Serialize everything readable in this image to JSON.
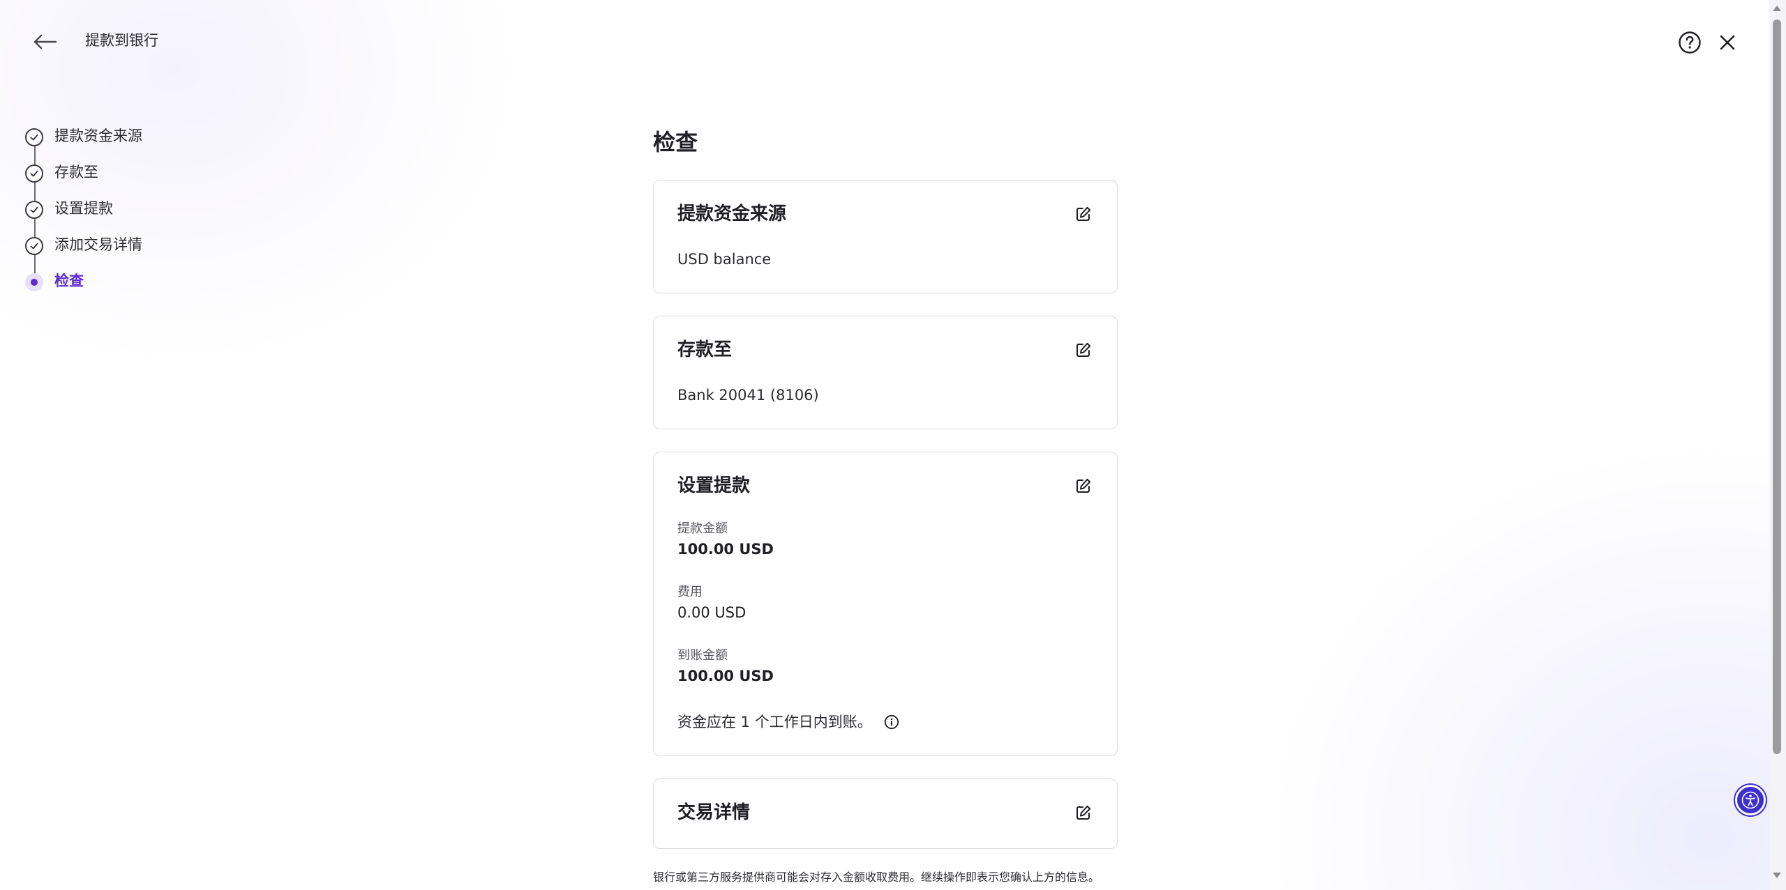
{
  "header": {
    "title": "提款到银行",
    "back_icon": "arrow-left-icon",
    "help_icon": "question-circle-icon",
    "close_icon": "close-icon"
  },
  "stepper": {
    "steps": [
      {
        "label": "提款资金来源",
        "state": "completed"
      },
      {
        "label": "存款至",
        "state": "completed"
      },
      {
        "label": "设置提款",
        "state": "completed"
      },
      {
        "label": "添加交易详情",
        "state": "completed"
      },
      {
        "label": "检查",
        "state": "current"
      }
    ],
    "accent_color": "#5a2bd1"
  },
  "main": {
    "title": "检查",
    "source_card": {
      "title": "提款资金来源",
      "value": "USD balance"
    },
    "deposit_card": {
      "title": "存款至",
      "value": "Bank 20041 (8106)"
    },
    "setup_card": {
      "title": "设置提款",
      "amount_label": "提款金额",
      "amount_value": "100.00 USD",
      "fee_label": "费用",
      "fee_value": "0.00 USD",
      "received_label": "到账金额",
      "received_value": "100.00 USD",
      "eta_text": "资金应在 1 个工作日内到账。"
    },
    "details_card": {
      "title": "交易详情"
    },
    "disclaimer": "银行或第三方服务提供商可能会对存入金额收取费用。继续操作即表示您确认上方的信息。"
  },
  "accessibility": {
    "icon": "accessibility-icon",
    "color": "#3b2fd0"
  }
}
